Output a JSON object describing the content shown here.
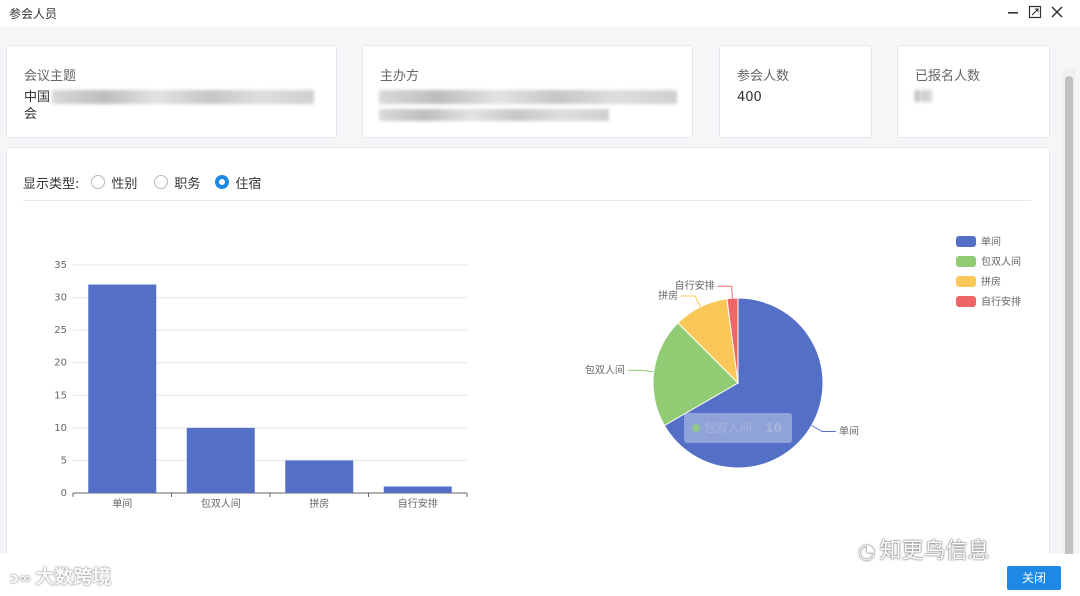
{
  "window": {
    "title": "参会人员",
    "minimize_icon": "minimize-icon",
    "maximize_icon": "maximize-icon",
    "close_icon": "close-icon"
  },
  "cards": [
    {
      "label": "会议主题",
      "value_start": "中国",
      "value_end": "会"
    },
    {
      "label": "主办方",
      "value_start": "",
      "value_end": ""
    },
    {
      "label": "参会人数",
      "value": "400"
    },
    {
      "label": "已报名人数",
      "value": ""
    }
  ],
  "filter": {
    "label": "显示类型:",
    "options": [
      {
        "label": "性别",
        "checked": false
      },
      {
        "label": "职务",
        "checked": false
      },
      {
        "label": "住宿",
        "checked": true
      }
    ]
  },
  "chart_data": [
    {
      "type": "bar",
      "categories": [
        "单间",
        "包双人间",
        "拼房",
        "自行安排"
      ],
      "values": [
        32,
        10,
        5,
        1
      ],
      "ylim": [
        0,
        35
      ],
      "yticks": [
        "0",
        "5",
        "10",
        "15",
        "20",
        "25",
        "30",
        "35"
      ],
      "color": "#5470c6",
      "grid": true
    },
    {
      "type": "pie",
      "categories": [
        "单间",
        "包双人间",
        "拼房",
        "自行安排"
      ],
      "values": [
        32,
        10,
        5,
        1
      ],
      "colors": [
        "#5470c6",
        "#91cc75",
        "#fac858",
        "#ee6666"
      ],
      "legend": "top-right",
      "tooltip": {
        "label": "包双人间",
        "value": "10"
      }
    }
  ],
  "watermarks": {
    "left": "大数跨境",
    "right": "知更鸟信息"
  },
  "footer": {
    "close_label": "关闭"
  }
}
